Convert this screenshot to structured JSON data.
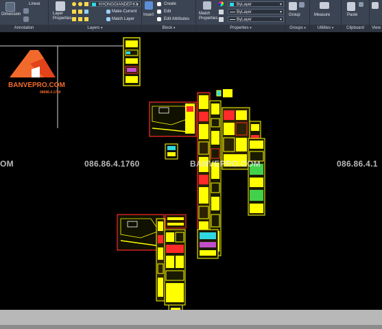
{
  "ribbon": {
    "annotation_panel": {
      "dimension_label": "Dimension",
      "linear_label": "Linear",
      "title": "Annotation"
    },
    "layers_panel": {
      "layer_properties_label": "Layer\nProperties",
      "current_layer": "KHONGGIANDEP.K1",
      "make_current_label": "Make Current",
      "match_layer_label": "Match Layer",
      "title": "Layers"
    },
    "block_panel": {
      "insert_label": "Insert",
      "create_label": "Create",
      "edit_label": "Edit",
      "edit_attributes_label": "Edit Attributes",
      "title": "Block"
    },
    "properties_panel": {
      "match_properties_label": "Match\nProperties",
      "color_value": "ByLayer",
      "linetype_value": "ByLayer",
      "lineweight_value": "ByLayer",
      "title": "Properties"
    },
    "groups_panel": {
      "group_label": "Group",
      "title": "Groups"
    },
    "utilities_panel": {
      "measure_label": "Measure",
      "title": "Utilities"
    },
    "clipboard_panel": {
      "paste_label": "Paste",
      "title": "Clipboard"
    },
    "view_panel": {
      "title": "View"
    }
  },
  "watermark": {
    "left_fragment": "OM",
    "phone_center": "086.86.4.1760",
    "brand_center": "BANVEPRO.COM",
    "phone_right": "086.86.4.1"
  },
  "logo": {
    "name": "BANVEPRO.COM",
    "phone": "08686.4.1760"
  },
  "colors": {
    "ribbon_bg": "#3b4453",
    "canvas_bg": "#000000",
    "drawing_yellow": "#ffff00",
    "drawing_red": "#ff2a2a",
    "drawing_cyan": "#2fd8e0",
    "brand_orange": "#f26a2b",
    "statusbar": "#b8b8b8"
  }
}
